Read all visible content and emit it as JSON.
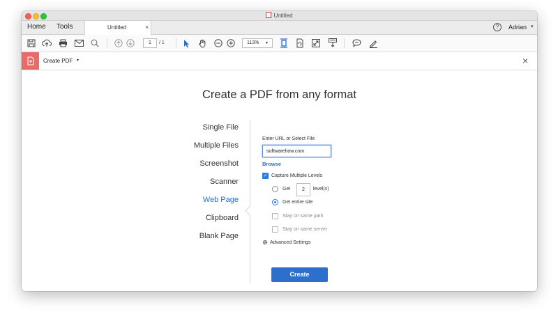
{
  "window": {
    "title": "Untitled"
  },
  "tabs": {
    "home": "Home",
    "tools": "Tools",
    "document": "Untitled",
    "close": "×"
  },
  "account": {
    "help": "?",
    "user": "Adrian"
  },
  "toolbar": {
    "page_current": "1",
    "page_total": "/ 1",
    "zoom": "113%"
  },
  "tool_header": {
    "title": "Create PDF",
    "close": "×"
  },
  "main": {
    "title": "Create a PDF from any format",
    "formats": [
      {
        "label": "Single File",
        "active": false
      },
      {
        "label": "Multiple Files",
        "active": false
      },
      {
        "label": "Screenshot",
        "active": false
      },
      {
        "label": "Scanner",
        "active": false
      },
      {
        "label": "Web Page",
        "active": true
      },
      {
        "label": "Clipboard",
        "active": false
      },
      {
        "label": "Blank Page",
        "active": false
      }
    ]
  },
  "web_page": {
    "url_label": "Enter URL or Select File",
    "url_value": "softwarehow.com",
    "browse": "Browse",
    "capture_multiple": {
      "label": "Capture Multiple Levels",
      "checked": true
    },
    "get_prefix": "Get",
    "levels_value": "2",
    "levels_suffix": "level(s)",
    "get_entire_site": "Get entire site",
    "stay_same_path": "Stay on same path",
    "stay_same_server": "Stay on same server",
    "advanced_settings": "Advanced Settings",
    "create_button": "Create"
  },
  "colors": {
    "accent": "#2c6fcd",
    "active_link": "#2b6fc8",
    "tool_icon_bg": "#ea6a6a"
  }
}
